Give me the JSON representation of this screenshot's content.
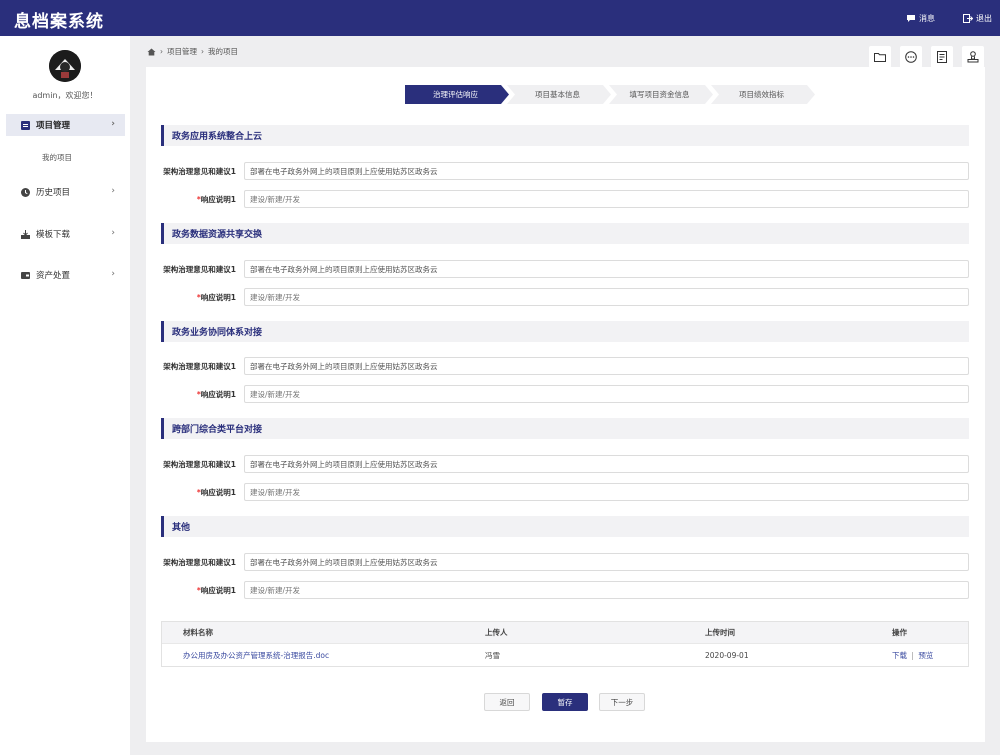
{
  "app": {
    "title": "息档案系统"
  },
  "header": {
    "messages_label": "消息",
    "logout_label": "退出"
  },
  "user": {
    "welcome": "admin，欢迎您！"
  },
  "sidebar": {
    "items": [
      {
        "label": "项目管理"
      },
      {
        "label": "历史项目"
      },
      {
        "label": "模板下载"
      },
      {
        "label": "资产处置"
      }
    ],
    "subitem": "我的项目"
  },
  "breadcrumb": {
    "level1": "项目管理",
    "level2": "我的项目"
  },
  "steps": [
    {
      "label": "治理评估响应"
    },
    {
      "label": "项目基本信息"
    },
    {
      "label": "填写项目资金信息"
    },
    {
      "label": "项目绩效指标"
    }
  ],
  "sections": [
    {
      "title": "政务应用系统整合上云",
      "suggest_label": "架构治理意见和建议1",
      "suggest_value": "部署在电子政务外网上的项目原则上应使用姑苏区政务云",
      "response_label": "响应说明1",
      "response_placeholder": "建设/新建/开发"
    },
    {
      "title": "政务数据资源共享交换",
      "suggest_label": "架构治理意见和建议1",
      "suggest_value": "部署在电子政务外网上的项目原则上应使用姑苏区政务云",
      "response_label": "响应说明1",
      "response_placeholder": "建设/新建/开发"
    },
    {
      "title": "政务业务协同体系对接",
      "suggest_label": "架构治理意见和建议1",
      "suggest_value": "部署在电子政务外网上的项目原则上应使用姑苏区政务云",
      "response_label": "响应说明1",
      "response_placeholder": "建设/新建/开发"
    },
    {
      "title": "跨部门综合类平台对接",
      "suggest_label": "架构治理意见和建议1",
      "suggest_value": "部署在电子政务外网上的项目原则上应使用姑苏区政务云",
      "response_label": "响应说明1",
      "response_placeholder": "建设/新建/开发"
    },
    {
      "title": "其他",
      "suggest_label": "架构治理意见和建议1",
      "suggest_value": "部署在电子政务外网上的项目原则上应使用姑苏区政务云",
      "response_label": "响应说明1",
      "response_placeholder": "建设/新建/开发"
    }
  ],
  "required_mark": "*",
  "table": {
    "headers": [
      "材料名称",
      "上传人",
      "上传时间",
      "操作"
    ],
    "rows": [
      {
        "name": "办公用房及办公资产管理系统-治理报告.doc",
        "uploader": "冯雪",
        "time": "2020-09-01",
        "action_download": "下载",
        "action_sep": "|",
        "action_preview": "预览"
      }
    ]
  },
  "buttons": {
    "back": "返回",
    "save": "暂存",
    "next": "下一步"
  },
  "colors": {
    "primary": "#2a2f7c",
    "required": "#e33333",
    "link": "#3b4ba0"
  },
  "icons": {
    "header": [
      "message-icon",
      "logout-icon"
    ],
    "sidebar": [
      "project-icon",
      "history-icon",
      "download-icon",
      "asset-icon"
    ],
    "toolbar": [
      "folder-icon",
      "more-icon",
      "document-icon",
      "user-stamp-icon"
    ]
  }
}
